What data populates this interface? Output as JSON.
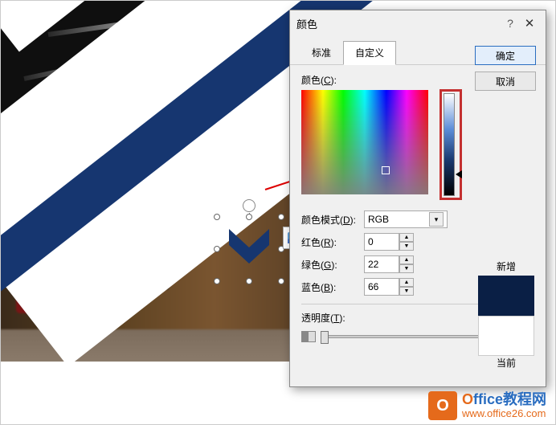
{
  "dialog": {
    "title": "颜色",
    "help": "?",
    "close": "✕",
    "tabs": {
      "standard": "标准",
      "custom": "自定义"
    },
    "buttons": {
      "ok": "确定",
      "cancel": "取消"
    },
    "labels": {
      "color": "颜色(C):",
      "color_u": "C",
      "model": "颜色模式(D):",
      "model_u": "D",
      "red": "红色(R):",
      "red_u": "R",
      "green": "绿色(G):",
      "green_u": "G",
      "blue": "蓝色(B):",
      "blue_u": "B",
      "trans": "透明度(T):",
      "trans_u": "T"
    },
    "values": {
      "model": "RGB",
      "red": "0",
      "green": "22",
      "blue": "66",
      "trans": "0 %",
      "new_color": "#0a1f45",
      "cur_color": "#ffffff"
    },
    "preview": {
      "new": "新增",
      "current": "当前"
    }
  },
  "watermark": {
    "logo": "O",
    "brand_prefix": "O",
    "brand_rest": "ffice教程网",
    "url": "www.office26.com"
  }
}
